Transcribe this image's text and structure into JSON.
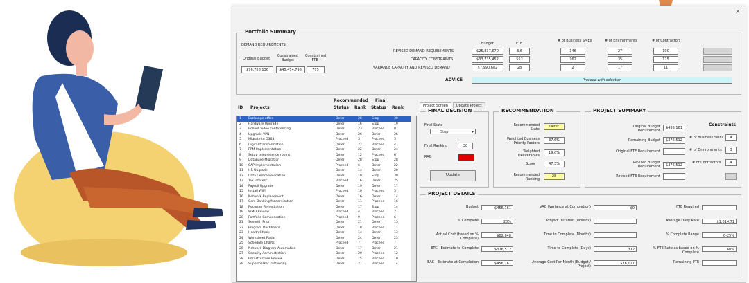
{
  "window": {
    "close": "×"
  },
  "portfolio": {
    "legend": "Portfolio Summary",
    "demand_label": "DEMAND REQUIREMENTS",
    "original_budget_label": "Original Budget",
    "constrained_budget_label": "Constrained Budget",
    "constrained_fte_label": "Constrained FTE",
    "original_budget": "$76,788,136",
    "constrained_budget": "$45,454,795",
    "constrained_fte": "775",
    "col_headers": [
      "Budget",
      "FTE",
      "# of Business SMEs",
      "# of Environments",
      "# of Contractors"
    ],
    "rows": [
      {
        "label": "REVISED DEMAND REQUIREMENTS",
        "values": [
          "$25,837,670",
          "3.6",
          "146",
          "27",
          "190"
        ]
      },
      {
        "label": "CAPACITY CONSTRAINTS",
        "values": [
          "$33,735,452",
          "552",
          "162",
          "35",
          "175"
        ]
      },
      {
        "label": "VARIANCE CAPACITY AND REVISED DEMAND",
        "values": [
          "$7,990,682",
          "28",
          "2",
          "17",
          "11"
        ]
      }
    ],
    "advice_label": "ADVICE",
    "advice_value": "Proceed with selection"
  },
  "list": {
    "headers": {
      "id": "ID",
      "projects": "Projects",
      "rec": "Recommended",
      "final": "Final",
      "status": "Status",
      "rank": "Rank",
      "status2": "Status",
      "rank2": "Rank"
    },
    "rows": [
      [
        "1",
        "Exchange office",
        "Defer",
        "28",
        "Stop",
        "30"
      ],
      [
        "2",
        "Hardware Upgrade",
        "Defer",
        "16",
        "Stop",
        "19"
      ],
      [
        "3",
        "Rollout video conferencing",
        "Defer",
        "23",
        "Proceed",
        "8"
      ],
      [
        "4",
        "Upgrade VPN",
        "Defer",
        "26",
        "Defer",
        "26"
      ],
      [
        "5",
        "Migrate to O365",
        "Proceed",
        "3",
        "Proceed",
        "3"
      ],
      [
        "6",
        "Digital transformation",
        "Defer",
        "22",
        "Proceed",
        "4"
      ],
      [
        "7",
        "PPM Implementation",
        "Defer",
        "22",
        "Defer",
        "24"
      ],
      [
        "8",
        "Setup telepresence rooms",
        "Defer",
        "12",
        "Proceed",
        "6"
      ],
      [
        "9",
        "Database Migration",
        "Defer",
        "28",
        "Stop",
        "28"
      ],
      [
        "10",
        "SAP Implementation",
        "Proceed",
        "6",
        "Defer",
        "22"
      ],
      [
        "11",
        "HR Upgrade",
        "Defer",
        "14",
        "Defer",
        "20"
      ],
      [
        "12",
        "Data Centre Relocation",
        "Defer",
        "19",
        "Stop",
        "30"
      ],
      [
        "13",
        "Tax Interest",
        "Proceed",
        "16",
        "Defer",
        "25"
      ],
      [
        "14",
        "Payroll Upgrade",
        "Defer",
        "19",
        "Defer",
        "17"
      ],
      [
        "15",
        "Install WiFi",
        "Proceed",
        "10",
        "Proceed",
        "5"
      ],
      [
        "16",
        "Network Replacement",
        "Defer",
        "16",
        "Defer",
        "14"
      ],
      [
        "17",
        "Core Banking Modernization",
        "Defer",
        "11",
        "Proceed",
        "16"
      ],
      [
        "18",
        "Recorder Remediation",
        "Defer",
        "17",
        "Stop",
        "14"
      ],
      [
        "19",
        "WMO Review",
        "Proceed",
        "4",
        "Proceed",
        "2"
      ],
      [
        "20",
        "Portfolio Compensation",
        "Proceed",
        "9",
        "Proceed",
        "6"
      ],
      [
        "21",
        "Seventh Prior",
        "Defer",
        "21",
        "Defer",
        "15"
      ],
      [
        "22",
        "Program Dashboard",
        "Defer",
        "18",
        "Proceed",
        "11"
      ],
      [
        "23",
        "Health Check",
        "Defer",
        "14",
        "Defer",
        "13"
      ],
      [
        "24",
        "Worksheet Radar",
        "Defer",
        "24",
        "Defer",
        "23"
      ],
      [
        "25",
        "Schedule Charts",
        "Proceed",
        "7",
        "Proceed",
        "7"
      ],
      [
        "26",
        "Network Diagram Automation",
        "Defer",
        "17",
        "Defer",
        "21"
      ],
      [
        "27",
        "Security Administration",
        "Defer",
        "20",
        "Proceed",
        "12"
      ],
      [
        "28",
        "Infrastructure Review",
        "Defer",
        "15",
        "Proceed",
        "10"
      ],
      [
        "29",
        "Supermarket Distancing",
        "Defer",
        "21",
        "Proceed",
        "14"
      ]
    ]
  },
  "tabs": [
    "Project Screen",
    "Update Project"
  ],
  "final_decision": {
    "legend": "FINAL DECISION",
    "final_state_label": "Final State",
    "final_state_value": "Stop",
    "final_ranking_label": "Final Ranking",
    "final_ranking_value": "30",
    "rag_label": "RAG",
    "rag_color": "#e00000",
    "update_label": "Update"
  },
  "recommendation": {
    "legend": "RECOMMENDATION",
    "items": [
      {
        "label": "Recommended State",
        "value": "Defer"
      },
      {
        "label": "Weighted Business Priority Factors",
        "value": "37.6%"
      },
      {
        "label": "Weighted Deliverables",
        "value": "19.0%"
      },
      {
        "label": "Score",
        "value": "47.3%"
      },
      {
        "label": "Recommended Ranking",
        "value": "28"
      }
    ],
    "highlight": "#ffffa8"
  },
  "project_summary": {
    "legend": "PROJECT SUMMARY",
    "constraints_label": "Constraints",
    "items": [
      {
        "label": "Original Budget Requirement",
        "value": "$435,161"
      },
      {
        "label": "Remaining Budget",
        "value": "$376,512"
      },
      {
        "label": "Original FTE Requirement",
        "value": ""
      },
      {
        "label": "Revised Budget Requirement",
        "value": "$376,512"
      },
      {
        "label": "Revised FTE Requirement",
        "value": ""
      }
    ],
    "constraints": [
      {
        "label": "# of Business SMEs",
        "value": "4"
      },
      {
        "label": "# of Environments",
        "value": "3"
      },
      {
        "label": "# of Contractors",
        "value": "4"
      }
    ]
  },
  "project_details": {
    "legend": "PROJECT DETAILS",
    "col1": [
      {
        "label": "Budget",
        "value": "$456,161"
      },
      {
        "label": "% Complete",
        "value": "20%"
      },
      {
        "label": "Actual Cost (based on % Complete)",
        "value": "$82,648"
      },
      {
        "label": "ETC - Estimate to Complete",
        "value": "$376,512"
      },
      {
        "label": "EAC - Estimate at Completion",
        "value": "$456,161"
      }
    ],
    "col2": [
      {
        "label": "VAC (Variance at Completion)",
        "value": "$0"
      },
      {
        "label": "Project Duration (Months)",
        "value": ""
      },
      {
        "label": "Time to Complete (Months)",
        "value": ""
      },
      {
        "label": "Time to Complete (Days)",
        "value": "372"
      },
      {
        "label": "Average Cost Per Month (Budget / Project)",
        "value": "$76,027"
      }
    ],
    "col3": [
      {
        "label": "FTE Required",
        "value": ""
      },
      {
        "label": "Average Daily Rate",
        "value": "$1,014.71"
      },
      {
        "label": "% Complete Range",
        "value": "0-25%"
      },
      {
        "label": "% FTE Rate as based on % Complete",
        "value": "60%"
      },
      {
        "label": "Remaining FTE",
        "value": ""
      }
    ]
  }
}
